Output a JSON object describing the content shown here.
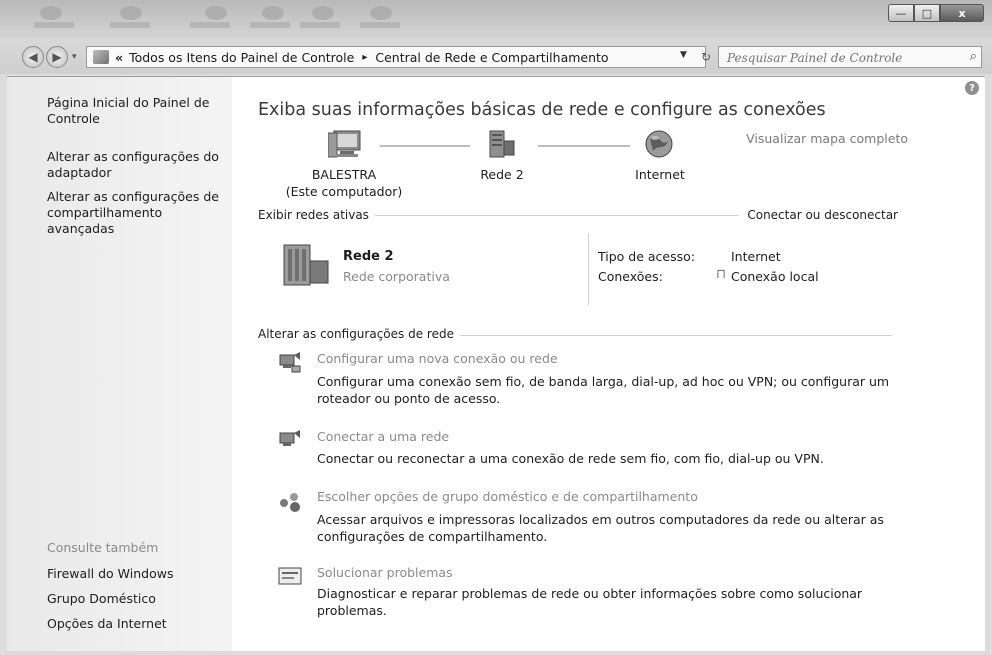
{
  "window": {
    "controls": {
      "minimize": "—",
      "maximize": "□",
      "close": "x"
    }
  },
  "nav": {
    "back": "◀",
    "forward": "▶"
  },
  "address": {
    "prefix": "«",
    "crumbs": [
      "Todos os Itens do Painel de Controle",
      "Central de Rede e Compartilhamento"
    ],
    "separator": "▸",
    "dropdown": "▼",
    "refresh": "↻"
  },
  "search": {
    "placeholder": "Pesquisar Painel de Controle",
    "icon": "⌕"
  },
  "sidebar": {
    "links": [
      "Página Inicial do Painel de Controle",
      "Alterar as configurações do adaptador",
      "Alterar as configurações de compartilhamento avançadas"
    ],
    "see_also_title": "Consulte também",
    "see_also": [
      "Firewall do Windows",
      "Grupo Doméstico",
      "Opções da Internet"
    ]
  },
  "main": {
    "help": "?",
    "title": "Exiba suas informações básicas de rede e configure as conexões",
    "map": {
      "computer_name": "BALESTRA",
      "computer_sub": "(Este computador)",
      "network": "Rede 2",
      "internet": "Internet",
      "full_map_link": "Visualizar mapa completo"
    },
    "active": {
      "header": "Exibir redes ativas",
      "connect_link": "Conectar ou desconectar",
      "network_name": "Rede 2",
      "network_type": "Rede corporativa",
      "access_label": "Tipo de acesso:",
      "access_value": "Internet",
      "connections_label": "Conexões:",
      "connections_value": "Conexão local"
    },
    "change": {
      "header": "Alterar as configurações de rede",
      "tasks": [
        {
          "title": "Configurar uma nova conexão ou rede",
          "desc": "Configurar uma conexão sem fio, de banda larga, dial-up, ad hoc ou VPN; ou configurar um roteador ou ponto de acesso."
        },
        {
          "title": "Conectar a uma rede",
          "desc": "Conectar ou reconectar a uma conexão de rede sem fio, com fio, dial-up ou VPN."
        },
        {
          "title": "Escolher opções de grupo doméstico e de compartilhamento",
          "desc": "Acessar arquivos e impressoras localizados em outros computadores da rede ou alterar as configurações de compartilhamento."
        },
        {
          "title": "Solucionar problemas",
          "desc": "Diagnosticar e reparar problemas de rede ou obter informações sobre como solucionar problemas."
        }
      ]
    }
  }
}
